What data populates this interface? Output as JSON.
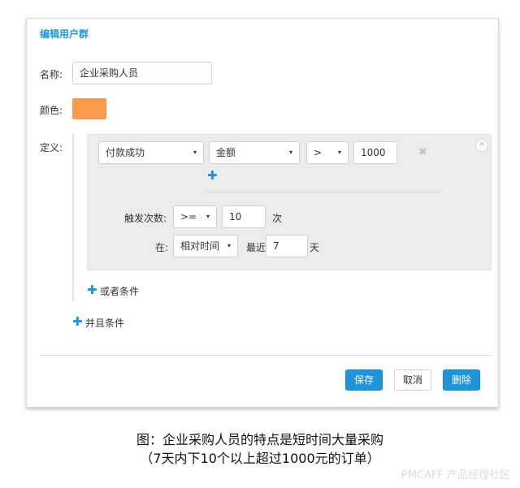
{
  "dialog": {
    "title": "编辑用户群",
    "name_label": "名称:",
    "name_value": "企业采购人员",
    "color_label": "颜色:",
    "color_value": "#f99a4c",
    "definition_label": "定义:"
  },
  "condition": {
    "event_select": "付款成功",
    "property_select": "金额",
    "operator_select": ">",
    "value": "1000",
    "trigger_count_label": "触发次数:",
    "trigger_operator": ">=",
    "trigger_value": "10",
    "trigger_unit": "次",
    "time_label": "在:",
    "time_type": "相对时间",
    "recent_label": "最近",
    "recent_value": "7",
    "recent_unit": "天"
  },
  "actions": {
    "or_condition": "或者条件",
    "and_condition": "并且条件",
    "save": "保存",
    "cancel": "取消",
    "delete": "删除"
  },
  "caption": {
    "line1": "图：企业采购人员的特点是短时间大量采购",
    "line2": "（7天内下10个以上超过1000元的订单）"
  },
  "watermark": "PMCAFF 产品经理社区",
  "icons": {
    "caret": "▾",
    "plus": "✚",
    "close": "✕",
    "remove": "✖"
  }
}
